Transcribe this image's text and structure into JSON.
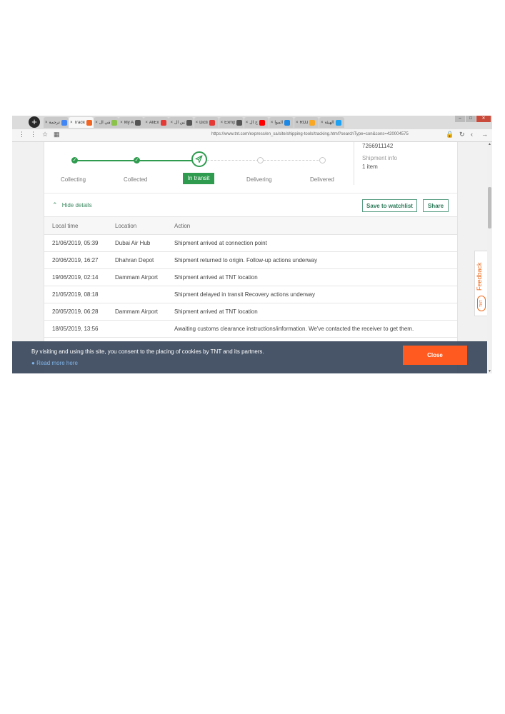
{
  "browser": {
    "new_tab": "+",
    "tabs": [
      {
        "label": "ترجمة",
        "close": "×",
        "fav": "#4285f4"
      },
      {
        "label": "Tracki",
        "close": "×",
        "fav": "#f26522",
        "active": true
      },
      {
        "label": "تلقي ال",
        "close": "×",
        "fav": "#8bc34a"
      },
      {
        "label": "My A",
        "close": "×",
        "fav": "#555555"
      },
      {
        "label": "AliEx",
        "close": "×",
        "fav": "#e53935"
      },
      {
        "label": "حين ال",
        "close": "×",
        "fav": "#555555"
      },
      {
        "label": "Dicti",
        "close": "×",
        "fav": "#e53935"
      },
      {
        "label": "Exmp",
        "close": "×",
        "fav": "#555555"
      },
      {
        "label": "ح ال",
        "close": "×",
        "fav": "#ff0000"
      },
      {
        "label": "الموا",
        "close": "×",
        "fav": "#1e88e5"
      },
      {
        "label": "ROJ",
        "close": "×",
        "fav": "#f9a825"
      },
      {
        "label": "الهيئة",
        "close": "×",
        "fav": "#1da1f2"
      }
    ],
    "url": "https://www.tnt.com/express/en_sa/site/shipping-tools/tracking.html?searchType=con&cons=420004575"
  },
  "progress": {
    "steps": [
      "Collecting",
      "Collected",
      "In transit",
      "Delivering",
      "Delivered"
    ],
    "current": "In transit"
  },
  "side": {
    "number": "7266911142",
    "info_label": "Shipment info",
    "items": "1 item"
  },
  "actions": {
    "hide_details": "Hide details",
    "watchlist": "Save to watchlist",
    "share": "Share"
  },
  "table": {
    "headers": [
      "Local time",
      "Location",
      "Action"
    ],
    "rows": [
      {
        "time": "21/06/2019, 05:39",
        "location": "Dubai Air Hub",
        "action": "Shipment arrived at connection point"
      },
      {
        "time": "20/06/2019, 16:27",
        "location": "Dhahran Depot",
        "action": "Shipment returned to origin. Follow-up actions underway"
      },
      {
        "time": "19/06/2019, 02:14",
        "location": "Dammam Airport",
        "action": "Shipment arrived at TNT location"
      },
      {
        "time": "21/05/2019, 08:18",
        "location": "",
        "action": "Shipment delayed in transit Recovery actions underway"
      },
      {
        "time": "20/05/2019, 06:28",
        "location": "Dammam Airport",
        "action": "Shipment arrived at TNT location"
      },
      {
        "time": "18/05/2019, 13:56",
        "location": "",
        "action": "Awaiting customs clearance instructions/information. We've contacted the receiver to get them."
      }
    ]
  },
  "cookie": {
    "text": "By visiting and using this site, you consent to the placing of cookies by TNT and its partners.",
    "more": "Read more here",
    "close": "Close"
  },
  "feedback": {
    "label": "Feedback",
    "logo": "TNT"
  },
  "colors": {
    "green": "#2e9b4e",
    "orange": "#ff5a1f",
    "banner": "#3a485c"
  }
}
